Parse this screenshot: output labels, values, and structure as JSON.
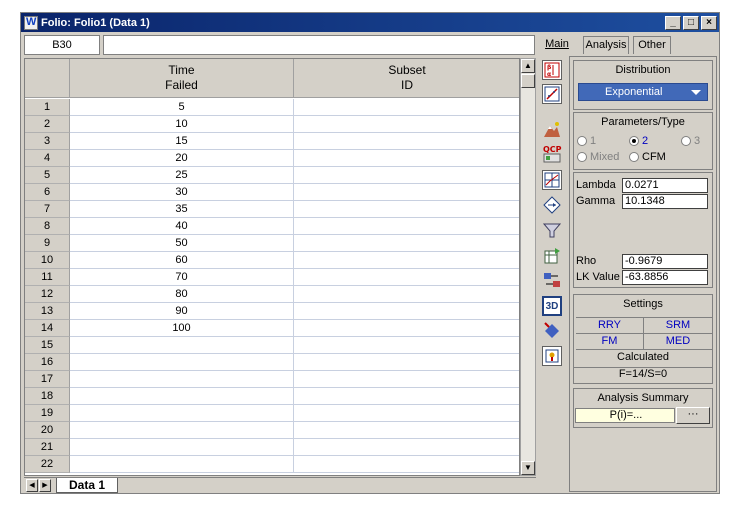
{
  "window": {
    "title": "Folio: Folio1 (Data 1)",
    "minimize": "_",
    "maximize": "□",
    "close": "×"
  },
  "formula_bar": {
    "cell_ref": "B30",
    "value": ""
  },
  "grid": {
    "columns": [
      {
        "line1": "Time",
        "line2": "Failed"
      },
      {
        "line1": "Subset",
        "line2": "ID"
      }
    ],
    "rows": [
      {
        "n": "1",
        "time": "5",
        "subset": ""
      },
      {
        "n": "2",
        "time": "10",
        "subset": ""
      },
      {
        "n": "3",
        "time": "15",
        "subset": ""
      },
      {
        "n": "4",
        "time": "20",
        "subset": ""
      },
      {
        "n": "5",
        "time": "25",
        "subset": ""
      },
      {
        "n": "6",
        "time": "30",
        "subset": ""
      },
      {
        "n": "7",
        "time": "35",
        "subset": ""
      },
      {
        "n": "8",
        "time": "40",
        "subset": ""
      },
      {
        "n": "9",
        "time": "50",
        "subset": ""
      },
      {
        "n": "10",
        "time": "60",
        "subset": ""
      },
      {
        "n": "11",
        "time": "70",
        "subset": ""
      },
      {
        "n": "12",
        "time": "80",
        "subset": ""
      },
      {
        "n": "13",
        "time": "90",
        "subset": ""
      },
      {
        "n": "14",
        "time": "100",
        "subset": ""
      },
      {
        "n": "15",
        "time": "",
        "subset": ""
      },
      {
        "n": "16",
        "time": "",
        "subset": ""
      },
      {
        "n": "17",
        "time": "",
        "subset": ""
      },
      {
        "n": "18",
        "time": "",
        "subset": ""
      },
      {
        "n": "19",
        "time": "",
        "subset": ""
      },
      {
        "n": "20",
        "time": "",
        "subset": ""
      },
      {
        "n": "21",
        "time": "",
        "subset": ""
      },
      {
        "n": "22",
        "time": "",
        "subset": ""
      }
    ]
  },
  "sheet_tabs": {
    "active": "Data 1"
  },
  "toolbar_icons": [
    "probability-plot-icon",
    "line-plot-icon",
    "mountain-chart-icon",
    "qcp-calculator-icon",
    "grid-chart-icon",
    "diamond-arrows-icon",
    "funnel-icon",
    "spreadsheet-transfer-icon",
    "data-transform-icon",
    "3d-plot-icon",
    "diamond-tool-icon",
    "report-icon"
  ],
  "panel": {
    "tabs": {
      "main": "Main",
      "analysis": "Analysis",
      "other": "Other"
    },
    "distribution": {
      "title": "Distribution",
      "selected": "Exponential"
    },
    "params": {
      "title": "Parameters/Type",
      "opt1": "1",
      "opt2": "2",
      "opt3": "3",
      "mixed": "Mixed",
      "cfm": "CFM"
    },
    "results": {
      "lambda_label": "Lambda",
      "lambda_value": "0.0271",
      "gamma_label": "Gamma",
      "gamma_value": "10.1348",
      "rho_label": "Rho",
      "rho_value": "-0.9679",
      "lk_label": "LK Value",
      "lk_value": "-63.8856"
    },
    "settings": {
      "title": "Settings",
      "rry": "RRY",
      "srm": "SRM",
      "fm": "FM",
      "med": "MED",
      "calculated": "Calculated",
      "fs": "F=14/S=0"
    },
    "summary": {
      "title": "Analysis Summary",
      "value": "P(i)=...",
      "button": "···"
    }
  }
}
